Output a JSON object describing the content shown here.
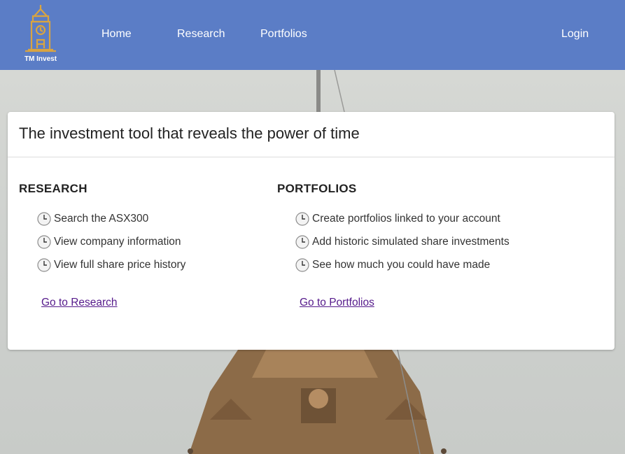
{
  "navbar": {
    "logo_text": "TM Invest",
    "links": {
      "home": "Home",
      "research": "Research",
      "portfolios": "Portfolios",
      "login": "Login"
    },
    "background_color": "#5b7dc6"
  },
  "card": {
    "title": "The investment tool that reveals the power of time",
    "research": {
      "heading": "RESEARCH",
      "items": [
        "Search the ASX300",
        "View company information",
        "View full share price history"
      ],
      "link": "Go to Research"
    },
    "portfolios": {
      "heading": "PORTFOLIOS",
      "items": [
        "Create portfolios linked to your account",
        "Add historic simulated share investments",
        "See how much you could have made"
      ],
      "link": "Go to Portfolios"
    }
  },
  "icons": {
    "bullet": "clock-icon",
    "logo": "clock-tower-logo"
  },
  "colors": {
    "link_visited": "#551a8b",
    "logo_gold": "#d9a441"
  }
}
